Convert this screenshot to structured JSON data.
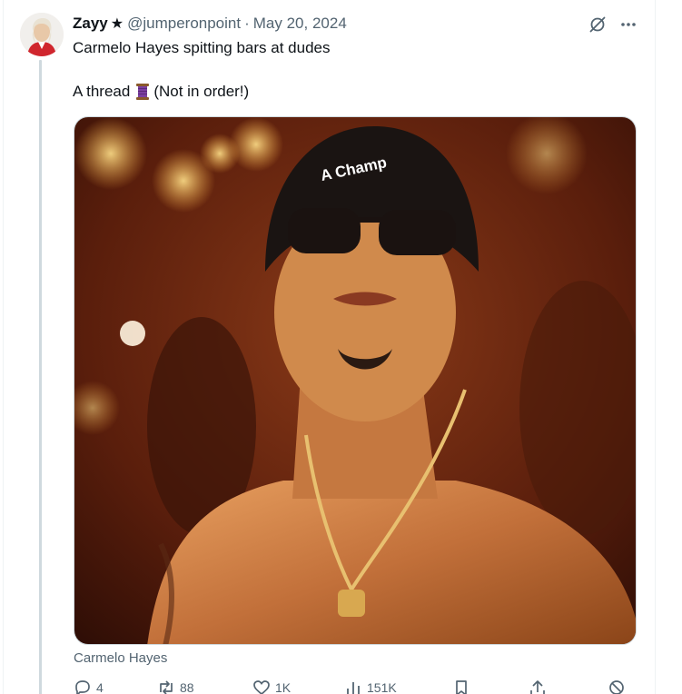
{
  "tweet": {
    "author": {
      "display_name": "Zayy",
      "name_badge": "★",
      "handle": "@jumperonpoint",
      "separator": "·",
      "date": "May 20, 2024"
    },
    "text_line1": "Carmelo Hayes spitting bars at dudes",
    "text_line2_prefix": "A thread",
    "text_line2_suffix": "(Not in order!)",
    "thread_emoji_icon": "thread-spool-icon",
    "media": {
      "hat_text": "A Champ"
    },
    "caption": "Carmelo Hayes",
    "actions": {
      "replies": "4",
      "reposts": "88",
      "likes": "1K",
      "views": "151K"
    }
  },
  "icons": {
    "grok": "grok-icon",
    "more": "more-icon",
    "reply": "reply-icon",
    "repost": "repost-icon",
    "like": "heart-icon",
    "views": "views-icon",
    "bookmark": "bookmark-icon",
    "share": "share-icon"
  },
  "colors": {
    "text_primary": "#0f1419",
    "text_secondary": "#536471",
    "border": "#cfd9de",
    "thread_icon": "#7b3fa0"
  }
}
